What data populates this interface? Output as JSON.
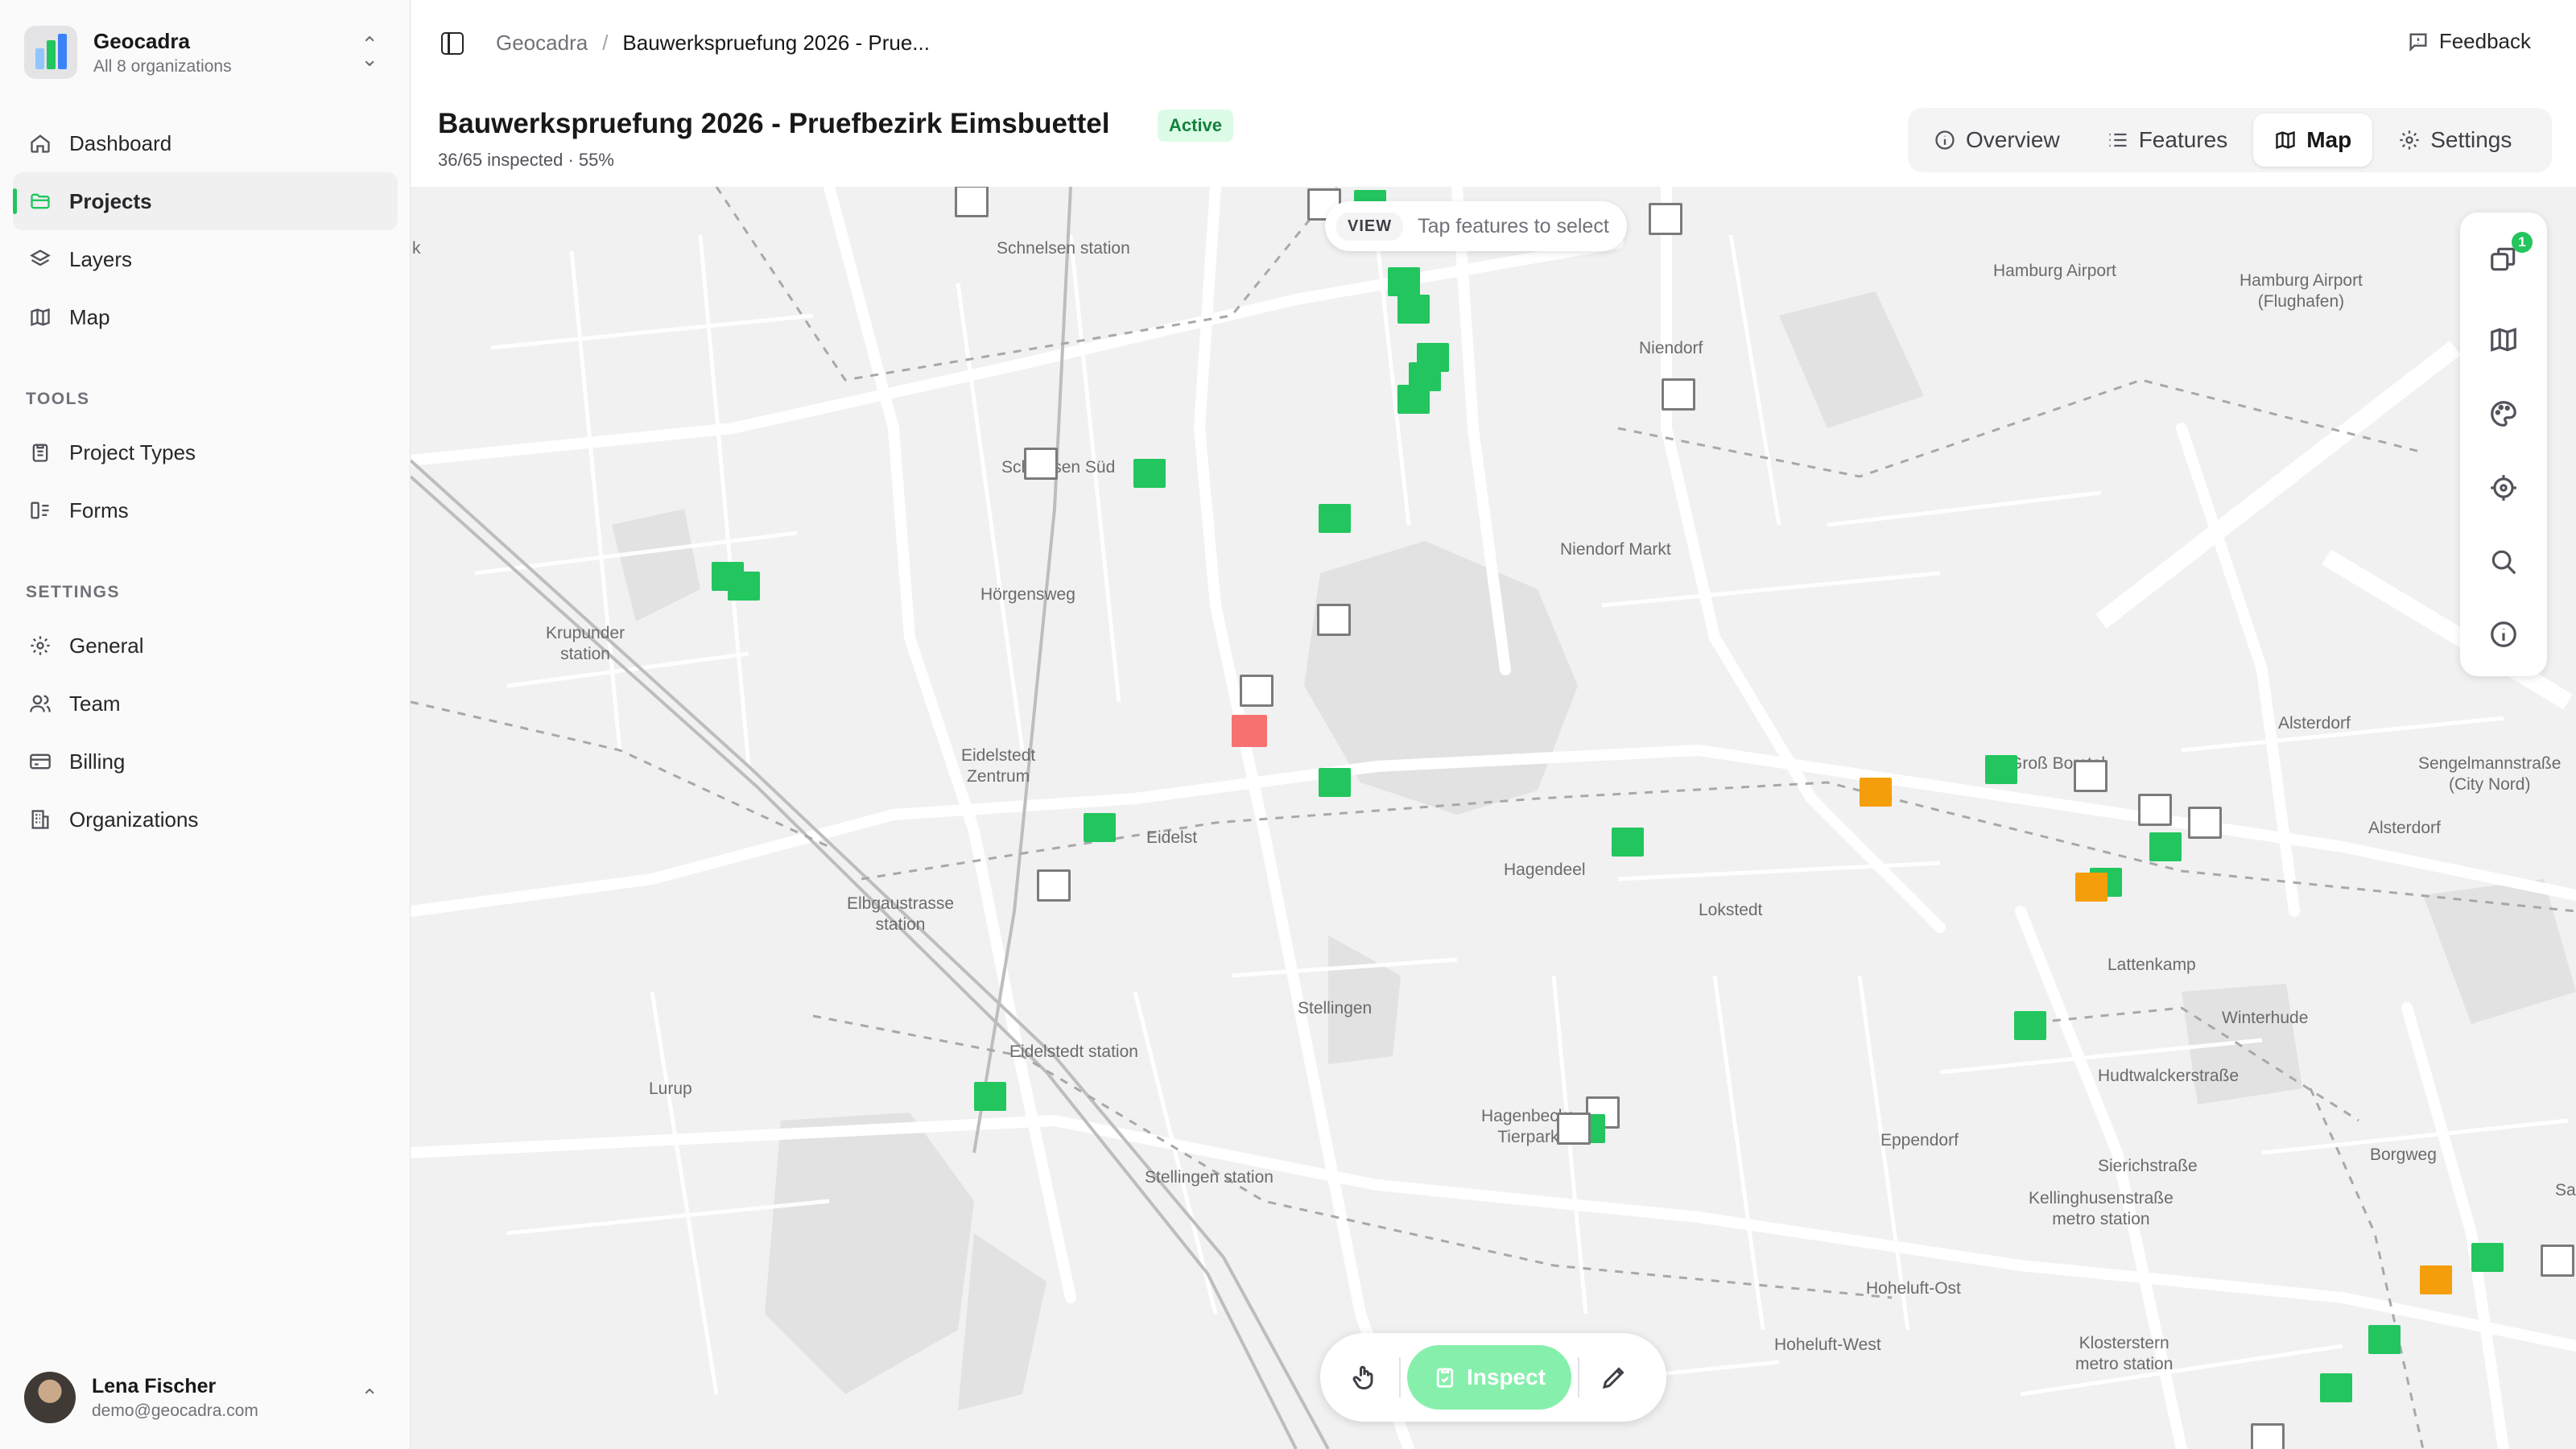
{
  "org": {
    "name": "Geocadra",
    "sub": "All 8 organizations"
  },
  "nav": [
    {
      "label": "Dashboard",
      "icon": "home-icon"
    },
    {
      "label": "Projects",
      "icon": "folder-icon",
      "active": true
    },
    {
      "label": "Layers",
      "icon": "layers-icon"
    },
    {
      "label": "Map",
      "icon": "map-icon"
    }
  ],
  "tools": {
    "label": "TOOLS",
    "items": [
      {
        "label": "Project Types",
        "icon": "clipboard-icon"
      },
      {
        "label": "Forms",
        "icon": "form-icon"
      }
    ]
  },
  "settings": {
    "label": "SETTINGS",
    "items": [
      {
        "label": "General",
        "icon": "gear-icon"
      },
      {
        "label": "Team",
        "icon": "users-icon"
      },
      {
        "label": "Billing",
        "icon": "card-icon"
      },
      {
        "label": "Organizations",
        "icon": "building-icon"
      }
    ]
  },
  "user": {
    "name": "Lena Fischer",
    "email": "demo@geocadra.com"
  },
  "breadcrumb": {
    "root": "Geocadra",
    "separator": "/",
    "current": "Bauwerkspruefung 2026 - Prue..."
  },
  "feedback_label": "Feedback",
  "project": {
    "title": "Bauwerkspruefung 2026 - Pruefbezirk Eimsbuettel",
    "status": "Active",
    "progress_text": "36/65 inspected · 55%"
  },
  "tabs": [
    {
      "label": "Overview",
      "icon": "info-icon"
    },
    {
      "label": "Features",
      "icon": "list-icon"
    },
    {
      "label": "Map",
      "icon": "map-icon",
      "active": true
    },
    {
      "label": "Settings",
      "icon": "gear-icon"
    }
  ],
  "map": {
    "mode_tag": "VIEW",
    "mode_hint": "Tap features to select",
    "layer_count": "1",
    "inspect_label": "Inspect",
    "places": [
      "k",
      "Schnelsen station",
      "Hamburg Airport",
      "Hamburg Airport\n(Flughafen)",
      "Niendorf",
      "Schnelsen Süd",
      "Niendorf Markt",
      "Hörgensweg",
      "Krupunder\nstation",
      "Alsterdorf",
      "Groß Borstel",
      "Sengelmannstraße\n(City Nord)",
      "Alsterdorf",
      "Eidelstedt\nZentrum",
      "Eidelst",
      "Hagendeel",
      "Lokstedt",
      "Elbgaustrasse\nstation",
      "Lattenkamp",
      "Stellingen",
      "Winterhude",
      "Eidelstedt station",
      "Hudtwalckerstraße",
      "Lurup",
      "Hagenbecks\nTierpark",
      "Eppendorf",
      "Sierichstraße",
      "Borgweg",
      "Stellingen station",
      "Kellinghusenstraße\nmetro station",
      "Sa",
      "Hoheluft-Ost",
      "Hoheluft-West",
      "Klosterstern\nmetro station"
    ]
  },
  "colors": {
    "accent": "#22c55e",
    "inspected": "#22c55e",
    "issue": "#f59e0b",
    "failed": "#f87171",
    "pending": "#ffffff"
  }
}
